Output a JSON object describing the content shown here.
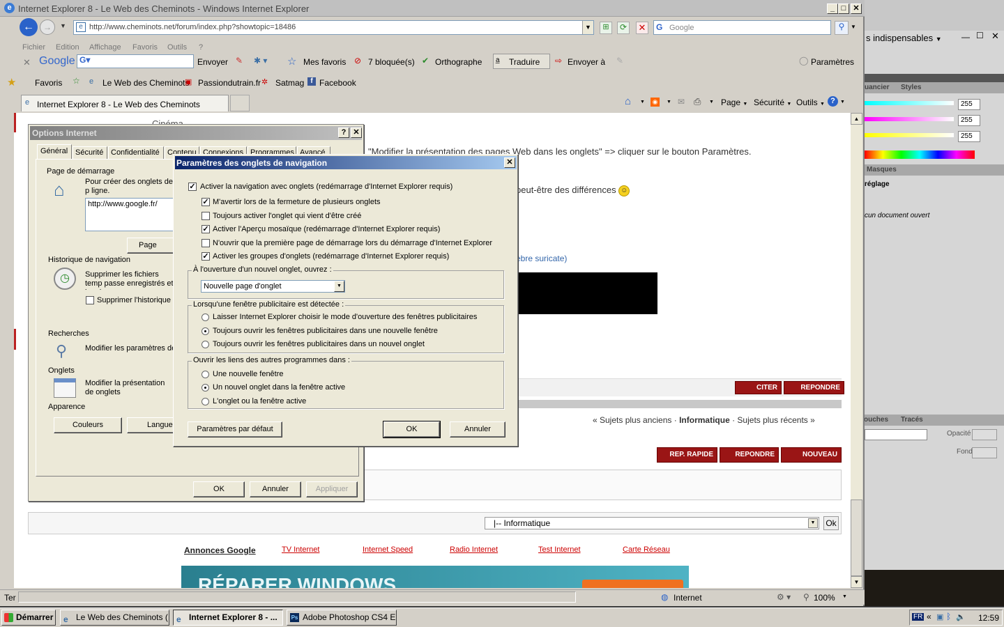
{
  "ie": {
    "window_title": "Internet Explorer 8 - Le Web des Cheminots - Windows Internet Explorer",
    "address": "http://www.cheminots.net/forum/index.php?showtopic=18486",
    "search_placeholder": "Google",
    "menu": [
      "Fichier",
      "Edition",
      "Affichage",
      "Favoris",
      "Outils",
      "?"
    ],
    "google_toolbar": {
      "brand": "Google",
      "send": "Envoyer",
      "favorites": "Mes favoris",
      "blocked": "7 bloquée(s)",
      "spelling": "Orthographe",
      "translate": "Traduire",
      "send_to": "Envoyer à",
      "settings": "Paramètres"
    },
    "favorites_bar": {
      "favorites": "Favoris",
      "links": [
        "Le Web des Cheminots",
        "Passiondutrain.fr",
        "Satmag",
        "Facebook"
      ]
    },
    "tab_title": "Internet Explorer 8 - Le Web des Cheminots",
    "command_bar": [
      "Page",
      "Sécurité",
      "Outils"
    ],
    "status": {
      "left": "Ter",
      "zone": "Internet",
      "zoom": "100%"
    }
  },
  "page": {
    "partial_heading": "Cinéma...",
    "line1": "\"Modifier la présentation des pages Web dans les onglets\" => cliquer sur le bouton Paramètres.",
    "line2": "peut-être des différences",
    "link": "èbre suricate)",
    "btn_quote": "CITER",
    "btn_reply": "REPONDRE",
    "nav_older": "« Sujets plus anciens",
    "nav_cat": "Informatique",
    "nav_newer": "Sujets plus récents »",
    "btn_quick": "REP. RAPIDE",
    "btn_reply2": "REPONDRE",
    "btn_new": "NOUVEAU",
    "jump_select": "|-- Informatique",
    "jump_ok": "Ok",
    "ads_title": "Annonces Google",
    "ads": [
      "TV Internet",
      "Internet Speed",
      "Radio Internet",
      "Test Internet",
      "Carte Réseau"
    ],
    "banner_text": "RÉPARER WINDOWS"
  },
  "options": {
    "title": "Options Internet",
    "tabs": [
      "Général",
      "Sécurité",
      "Confidentialité",
      "Contenu",
      "Connexions",
      "Programmes",
      "Avancé"
    ],
    "home_section": "Page de démarrage",
    "home_desc": "Pour créer des onglets de p ligne.",
    "home_url": "http://www.google.fr/",
    "btn_current": "Page actue",
    "history_section": "Historique de navigation",
    "history_desc": "Supprimer les fichiers temp passe enregistrés et les do",
    "history_cb": "Supprimer l'historique c",
    "search_section": "Recherches",
    "search_desc": "Modifier les paramètres de",
    "tabs_section": "Onglets",
    "tabs_desc": "Modifier la présentation de onglets",
    "appearance_section": "Apparence",
    "btn_colors": "Couleurs",
    "btn_languages": "Langues",
    "btn_ok": "OK",
    "btn_cancel": "Annuler",
    "btn_apply": "Appliquer"
  },
  "tabsettings": {
    "title": "Paramètres des onglets de navigation",
    "enable": "Activer la navigation avec onglets (redémarrage d'Internet Explorer requis)",
    "options": [
      {
        "label": "M'avertir lors de la fermeture de plusieurs onglets",
        "checked": true
      },
      {
        "label": "Toujours activer l'onglet qui vient d'être créé",
        "checked": false
      },
      {
        "label": "Activer l'Aperçu mosaïque (redémarrage d'Internet Explorer requis)",
        "checked": true
      },
      {
        "label": "N'ouvrir que la première page de démarrage lors du démarrage d'Internet Explorer",
        "checked": false
      },
      {
        "label": "Activer les groupes d'onglets (redémarrage d'Internet Explorer requis)",
        "checked": true
      }
    ],
    "newtab_group": "À l'ouverture d'un nouvel onglet, ouvrez :",
    "newtab_value": "Nouvelle page d'onglet",
    "popup_group": "Lorsqu'une fenêtre publicitaire est détectée :",
    "popup_options": [
      "Laisser Internet Explorer choisir le mode d'ouverture des fenêtres publicitaires",
      "Toujours ouvrir les fenêtres publicitaires dans une nouvelle fenêtre",
      "Toujours ouvrir les fenêtres publicitaires dans un nouvel onglet"
    ],
    "popup_selected": 1,
    "links_group": "Ouvrir les liens des autres programmes dans :",
    "links_options": [
      "Une nouvelle fenêtre",
      "Un nouvel onglet dans la fenêtre active",
      "L'onglet ou la fenêtre active"
    ],
    "links_selected": 1,
    "btn_defaults": "Paramètres par défaut",
    "btn_ok": "OK",
    "btn_cancel": "Annuler"
  },
  "photoshop": {
    "workspace": "s indispensables",
    "panel_tabs1": [
      "uancier",
      "Styles"
    ],
    "color_values": [
      "255",
      "255",
      "255"
    ],
    "panel_tabs2": [
      "Masques"
    ],
    "mask_label": "réglage",
    "mask_empty": "cun document ouvert",
    "panel_tabs3": [
      "ouches",
      "Tracés"
    ],
    "opacity": "Opacité :",
    "fill": "Fond :"
  },
  "taskbar": {
    "start": "Démarrer",
    "items": [
      "Le Web des Cheminots (...",
      "Internet Explorer 8 - ...",
      "Adobe Photoshop CS4 E..."
    ],
    "lang": "FR",
    "time": "12:59"
  }
}
